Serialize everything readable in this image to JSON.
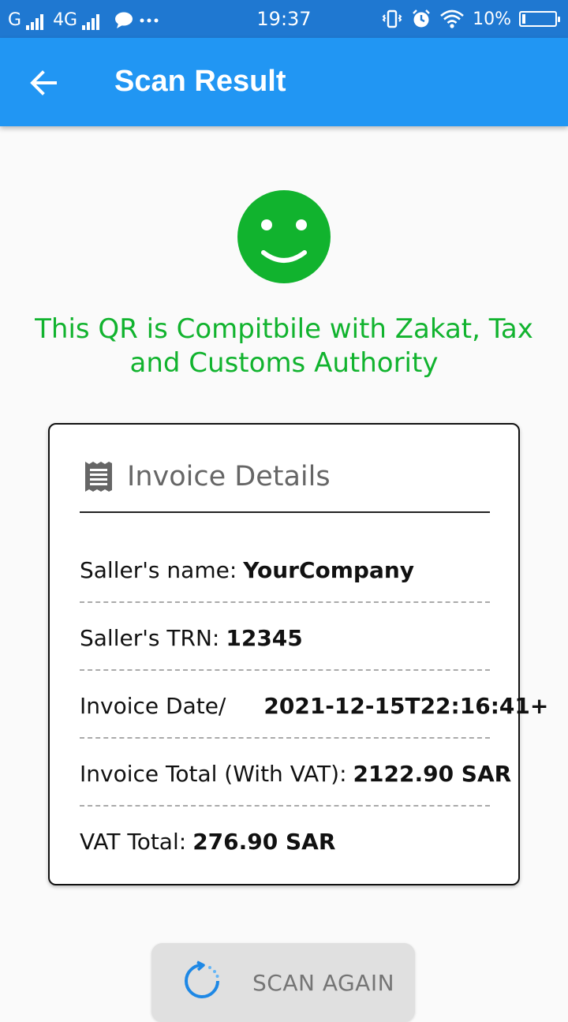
{
  "status_bar": {
    "carrier_left": "G",
    "network": "4G",
    "time": "19:37",
    "battery": "10%",
    "battery_level": 0.1
  },
  "appbar": {
    "title": "Scan Result"
  },
  "result": {
    "message": "This QR is Compitbile with Zakat, Tax and Customs Authority",
    "accent_color": "#11b32e"
  },
  "invoice": {
    "title": "Invoice Details",
    "rows": [
      {
        "label": "Saller's name:",
        "value": "YourCompany"
      },
      {
        "label": "Saller's TRN:",
        "value": "12345"
      },
      {
        "label": "Invoice Date/",
        "value": "2021-12-15T22:16:41+"
      },
      {
        "label": "Invoice Total (With VAT):",
        "value": "2122.90 SAR"
      },
      {
        "label": "VAT Total:",
        "value": "276.90 SAR"
      }
    ]
  },
  "actions": {
    "scan_again": "SCAN AGAIN"
  },
  "colors": {
    "appbar": "#2196f3",
    "statusbar": "#1f78d1",
    "success": "#11b32e"
  }
}
